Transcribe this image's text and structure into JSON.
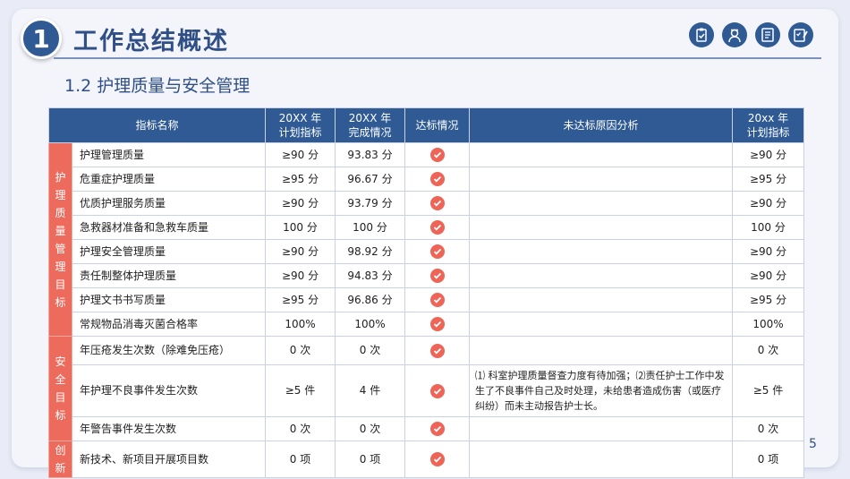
{
  "header": {
    "section_number": "1",
    "title": "工作总结概述",
    "subtitle": "1.2  护理质量与安全管理",
    "icons": [
      "clipboard-icon",
      "nurse-icon",
      "document-list-icon",
      "checklist-icon"
    ]
  },
  "table": {
    "headers": {
      "indicator": "指标名称",
      "plan_line1": "20XX 年",
      "plan_line2": "计划指标",
      "done_line1": "20XX 年",
      "done_line2": "完成情况",
      "status": "达标情况",
      "reason": "未达标原因分析",
      "next_line1": "20xx 年",
      "next_line2": "计划指标"
    },
    "categories": {
      "quality": "护理质量管理目标",
      "safety": "安全目标",
      "innovation": "创新"
    },
    "rows": [
      {
        "name": "护理管理质量",
        "plan": "≥90 分",
        "done": "93.83 分",
        "reason": "",
        "next": "≥90 分"
      },
      {
        "name": "危重症护理质量",
        "plan": "≥95 分",
        "done": "96.67 分",
        "reason": "",
        "next": "≥95 分"
      },
      {
        "name": "优质护理服务质量",
        "plan": "≥90 分",
        "done": "93.79 分",
        "reason": "",
        "next": "≥90 分"
      },
      {
        "name": "急救器材准备和急救车质量",
        "plan": "100 分",
        "done": "100 分",
        "reason": "",
        "next": "100 分"
      },
      {
        "name": "护理安全管理质量",
        "plan": "≥90 分",
        "done": "98.92 分",
        "reason": "",
        "next": "≥90 分"
      },
      {
        "name": "责任制整体护理质量",
        "plan": "≥90 分",
        "done": "94.83 分",
        "reason": "",
        "next": "≥90 分"
      },
      {
        "name": "护理文书书写质量",
        "plan": "≥95 分",
        "done": "96.86 分",
        "reason": "",
        "next": "≥95 分"
      },
      {
        "name": "常规物品消毒灭菌合格率",
        "plan": "100%",
        "done": "100%",
        "reason": "",
        "next": "100%"
      },
      {
        "name": "年压疮发生次数（除难免压疮）",
        "plan": "0 次",
        "done": "0 次",
        "reason": "",
        "next": "0 次"
      },
      {
        "name": "年护理不良事件发生次数",
        "plan": "≥5 件",
        "done": "4 件",
        "reason": "⑴ 科室护理质量督查力度有待加强；⑵责任护士工作中发生了不良事件自己及时处理，未给患者造成伤害（或医疗纠纷）而未主动报告护士长。",
        "next": "≥5 件"
      },
      {
        "name": "年警告事件发生次数",
        "plan": "0 次",
        "done": "0 次",
        "reason": "",
        "next": "0 次"
      },
      {
        "name": "新技术、新项目开展项目数",
        "plan": "0 项",
        "done": "0 项",
        "reason": "",
        "next": "0 项"
      }
    ]
  },
  "footer": {
    "page_number": "5"
  },
  "colors": {
    "primary": "#2f5a93",
    "accent": "#ed6b5d",
    "background": "#e9ecf6"
  }
}
